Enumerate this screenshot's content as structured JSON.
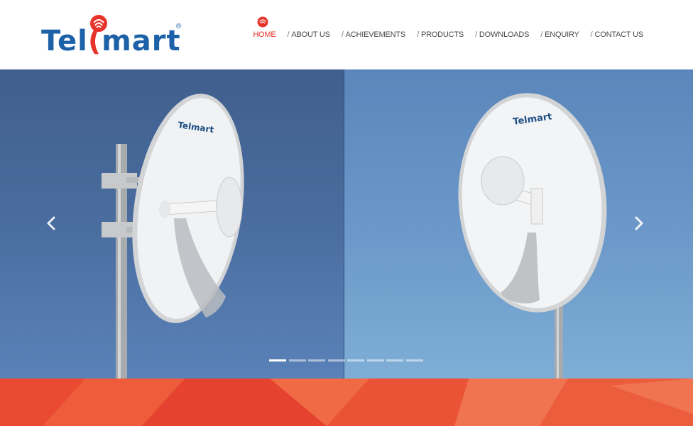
{
  "logo": {
    "text_before": "Tel",
    "text_after": "mart",
    "registered": "®",
    "brand_blue": "#1d62a8",
    "brand_red": "#e8332a"
  },
  "nav": {
    "items": [
      {
        "label": "HOME",
        "active": true
      },
      {
        "label": "ABOUT US",
        "active": false
      },
      {
        "label": "ACHIEVEMENTS",
        "active": false
      },
      {
        "label": "PRODUCTS",
        "active": false
      },
      {
        "label": "DOWNLOADS",
        "active": false
      },
      {
        "label": "ENQUIRY",
        "active": false
      },
      {
        "label": "CONTACT US",
        "active": false
      }
    ],
    "separator": "/",
    "home_icon": "signal-wave-icon"
  },
  "slider": {
    "prev_icon": "chevron-left-icon",
    "next_icon": "chevron-right-icon",
    "slide_count": 8,
    "active_index": 0,
    "dish_brand_left": "Telmart",
    "dish_brand_right": "Telmart"
  },
  "footer": {
    "band_color": "#ea5336"
  }
}
